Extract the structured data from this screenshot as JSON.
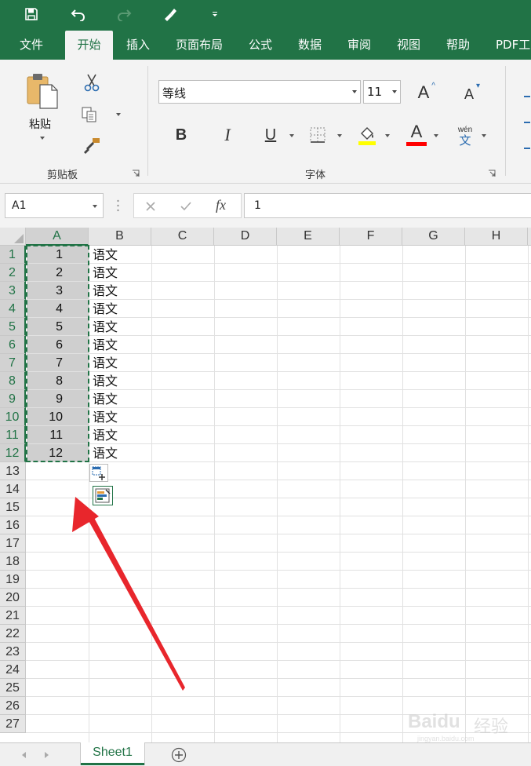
{
  "quick_access": {
    "icons": [
      "save-icon",
      "undo-icon",
      "redo-icon",
      "touch-mode-icon",
      "customize-dropdown-icon"
    ]
  },
  "tabs": [
    {
      "label": "文件",
      "active": false
    },
    {
      "label": "开始",
      "active": true
    },
    {
      "label": "插入",
      "active": false
    },
    {
      "label": "页面布局",
      "active": false
    },
    {
      "label": "公式",
      "active": false
    },
    {
      "label": "数据",
      "active": false
    },
    {
      "label": "审阅",
      "active": false
    },
    {
      "label": "视图",
      "active": false
    },
    {
      "label": "帮助",
      "active": false
    },
    {
      "label": "PDF工",
      "active": false
    }
  ],
  "ribbon": {
    "clipboard": {
      "label": "剪贴板",
      "paste_label": "粘贴"
    },
    "font": {
      "label": "字体",
      "font_name": "等线",
      "font_size": "11",
      "bold": "B",
      "italic": "I",
      "underline": "U",
      "font_color_letter": "A",
      "grow": "A",
      "shrink": "A",
      "phonetic_top": "wén",
      "phonetic_bottom": "文",
      "highlight_color": "#ffff00",
      "font_color": "#ff0000"
    }
  },
  "formula_bar": {
    "name_box": "A1",
    "fx": "fx",
    "value": "1"
  },
  "grid": {
    "columns": [
      "A",
      "B",
      "C",
      "D",
      "E",
      "F",
      "G",
      "H"
    ],
    "selected_column": "A",
    "rows": [
      "1",
      "2",
      "3",
      "4",
      "5",
      "6",
      "7",
      "8",
      "9",
      "10",
      "11",
      "12",
      "13",
      "14",
      "15",
      "16",
      "17",
      "18",
      "19",
      "20",
      "21",
      "22",
      "23",
      "24",
      "25",
      "26",
      "27"
    ],
    "col_a_values": [
      "1",
      "2",
      "3",
      "4",
      "5",
      "6",
      "7",
      "8",
      "9",
      "10",
      "11",
      "12"
    ],
    "col_b_values": [
      "语文",
      "语文",
      "语文",
      "语文",
      "语文",
      "语文",
      "语文",
      "语文",
      "语文",
      "语文",
      "语文",
      "语文"
    ],
    "selection_color": "#217346",
    "annotation_arrow_color": "#e8262c"
  },
  "sheets": {
    "active": "Sheet1"
  },
  "watermark": {
    "brand": "Baidu",
    "suffix": "经验",
    "url": "jingyan.baidu.com"
  }
}
